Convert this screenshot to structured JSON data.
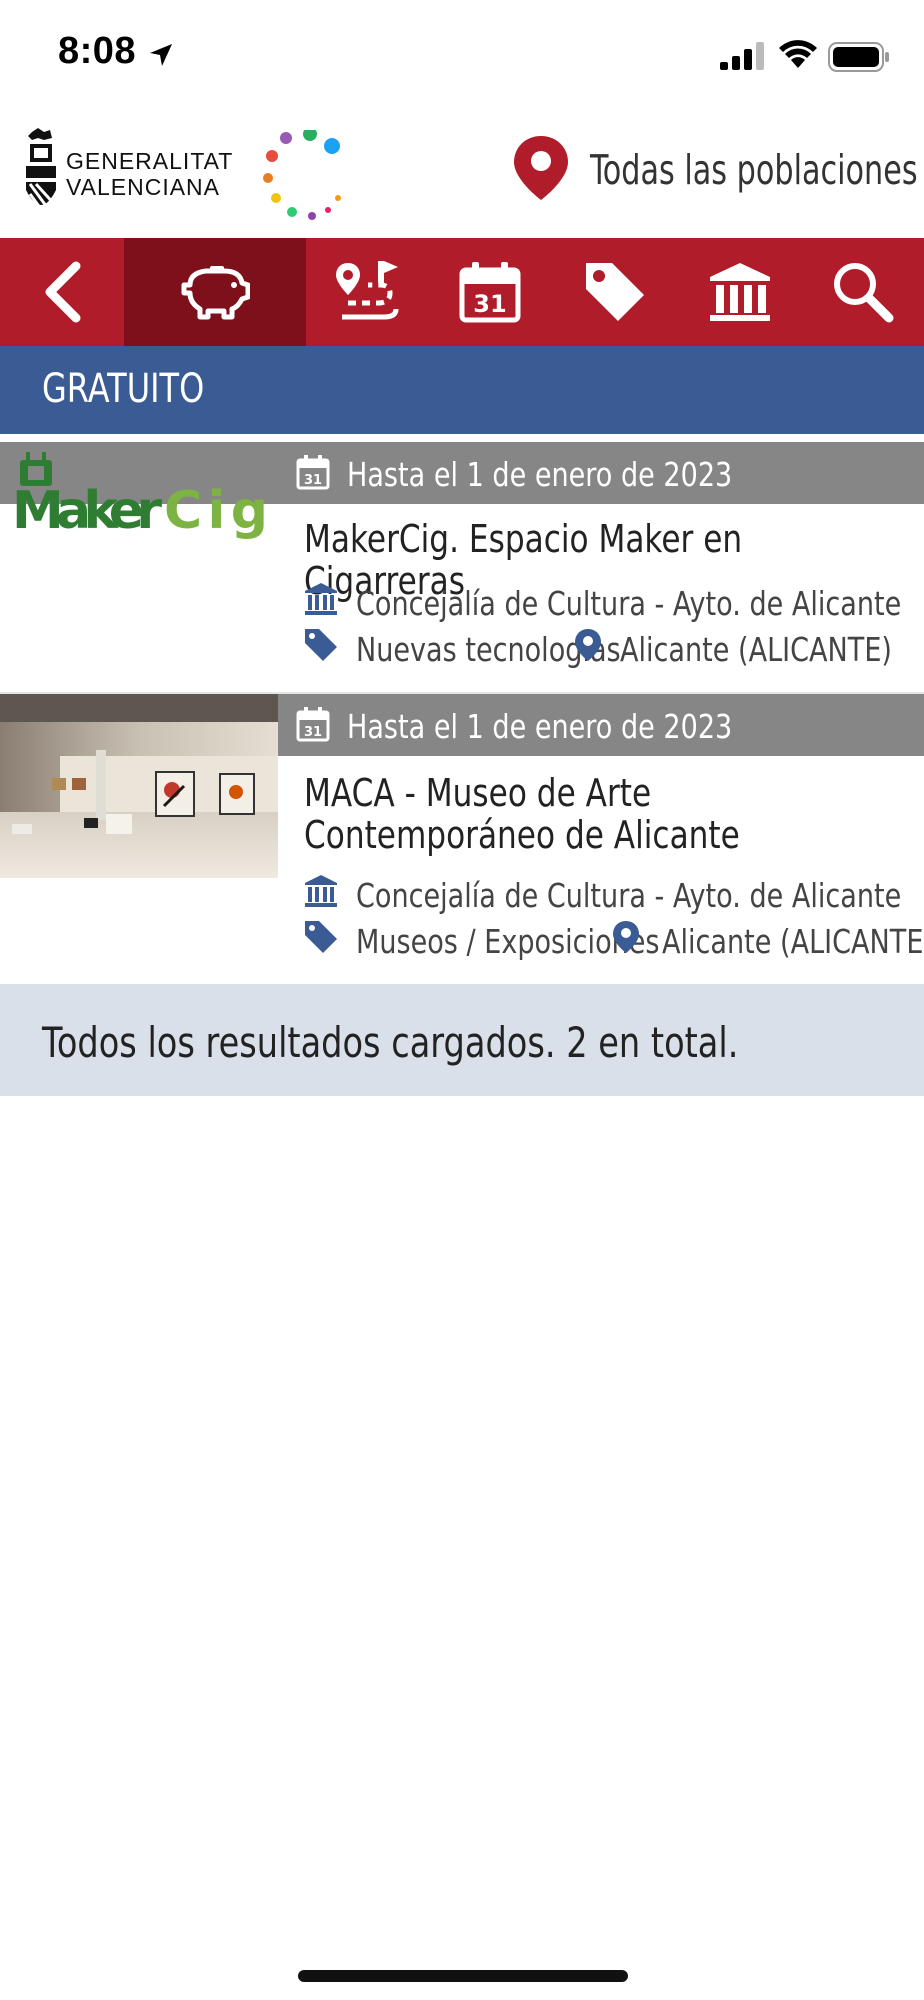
{
  "status_bar": {
    "time": "8:08",
    "icons": [
      "location-arrow-icon",
      "cellular-signal-icon",
      "wifi-icon",
      "battery-icon"
    ]
  },
  "header": {
    "brand_line1": "GENERALITAT",
    "brand_line2": "VALENCIANA",
    "location_label": "Todas las poblaciones"
  },
  "navbar": {
    "items": [
      {
        "name": "back",
        "icon": "chevron-left-icon",
        "active": false
      },
      {
        "name": "free",
        "icon": "piggy-bank-icon",
        "active": true
      },
      {
        "name": "routes",
        "icon": "route-icon",
        "active": false
      },
      {
        "name": "calendar",
        "icon": "calendar-icon",
        "active": false
      },
      {
        "name": "categories",
        "icon": "tag-icon",
        "active": false
      },
      {
        "name": "institutions",
        "icon": "museum-icon",
        "active": false
      },
      {
        "name": "search",
        "icon": "search-icon",
        "active": false
      }
    ],
    "calendar_day": "31"
  },
  "section": {
    "title": "GRATUITO"
  },
  "results": [
    {
      "date_text": "Hasta el 1 de enero de 2023",
      "thumb_text": "MakerCig",
      "title": "MakerCig. Espacio Maker en Cigarreras",
      "organizer": "Concejalía de Cultura - Ayto. de Alicante",
      "category": "Nuevas tecnologías",
      "location": "Alicante (ALICANTE)"
    },
    {
      "date_text": "Hasta el 1 de enero de 2023",
      "title": "MACA - Museo de Arte Contemporáneo de Alicante",
      "organizer": "Concejalía de Cultura - Ayto. de Alicante",
      "category": "Museos / Exposiciones",
      "location": "Alicante (ALICANTE)"
    }
  ],
  "footer": {
    "message": "Todos los resultados cargados. 2 en total."
  },
  "colors": {
    "brand_red": "#b01c2a",
    "active_red": "#7e101c",
    "section_blue": "#3a5b94",
    "icon_blue": "#3a5b94",
    "date_bar_gray": "#868686",
    "footer_bg": "#dae0ea"
  }
}
